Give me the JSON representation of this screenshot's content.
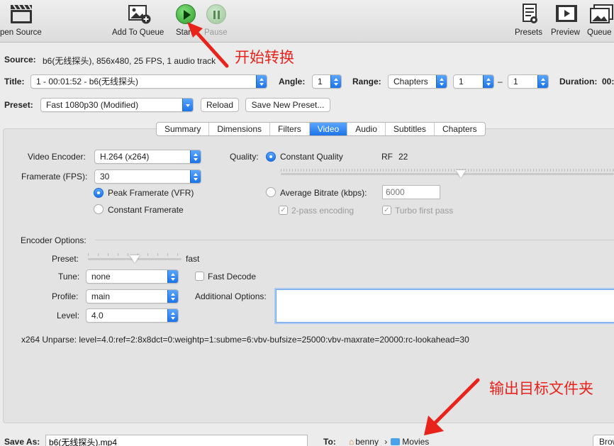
{
  "toolbar": {
    "open_source": "pen Source",
    "add_to_queue": "Add To Queue",
    "start": "Start",
    "pause": "Pause",
    "presets": "Presets",
    "preview": "Preview",
    "queue": "Queue"
  },
  "source": {
    "label": "Source:",
    "value": "b6(无线探头), 856x480, 25 FPS, 1 audio track"
  },
  "title_row": {
    "title_label": "Title:",
    "title_value": "1 - 00:01:52 - b6(无线探头)",
    "angle_label": "Angle:",
    "angle_value": "1",
    "range_label": "Range:",
    "range_type": "Chapters",
    "range_from": "1",
    "range_dash": "–",
    "range_to": "1",
    "duration_label": "Duration:",
    "duration_value": "00:"
  },
  "preset_row": {
    "label": "Preset:",
    "value": "Fast 1080p30 (Modified)",
    "reload": "Reload",
    "save_new": "Save New Preset..."
  },
  "tabs": [
    "Summary",
    "Dimensions",
    "Filters",
    "Video",
    "Audio",
    "Subtitles",
    "Chapters"
  ],
  "active_tab": "Video",
  "video": {
    "encoder_label": "Video Encoder:",
    "encoder_value": "H.264 (x264)",
    "framerate_label": "Framerate (FPS):",
    "framerate_value": "30",
    "peak_label": "Peak Framerate (VFR)",
    "constant_label": "Constant Framerate",
    "quality_label": "Quality:",
    "cq_label": "Constant Quality",
    "rf_label": "RF",
    "rf_value": "22",
    "rf_fraction": 0.54,
    "avg_label": "Average Bitrate (kbps):",
    "avg_placeholder": "6000",
    "two_pass_label": "2-pass encoding",
    "turbo_label": "Turbo first pass",
    "check_mark": "✓"
  },
  "encoder_options": {
    "heading": "Encoder Options:",
    "preset_label": "Preset:",
    "preset_value": "fast",
    "preset_fraction": 0.5,
    "tune_label": "Tune:",
    "tune_value": "none",
    "fast_decode_label": "Fast Decode",
    "profile_label": "Profile:",
    "profile_value": "main",
    "additional_label": "Additional Options:",
    "level_label": "Level:",
    "level_value": "4.0",
    "unparse": "x264 Unparse: level=4.0:ref=2:8x8dct=0:weightp=1:subme=6:vbv-bufsize=25000:vbv-maxrate=20000:rc-lookahead=30"
  },
  "save": {
    "label": "Save As:",
    "value": "b6(无线探头).mp4",
    "to_label": "To:",
    "user": "benny",
    "path_sep": "›",
    "folder": "Movies",
    "browse": "Brow"
  },
  "annotations": {
    "start_note": "开始转换",
    "output_note": "输出目标文件夹"
  },
  "colors": {
    "accent": "#1c74e8",
    "annotation": "#e8231c"
  }
}
